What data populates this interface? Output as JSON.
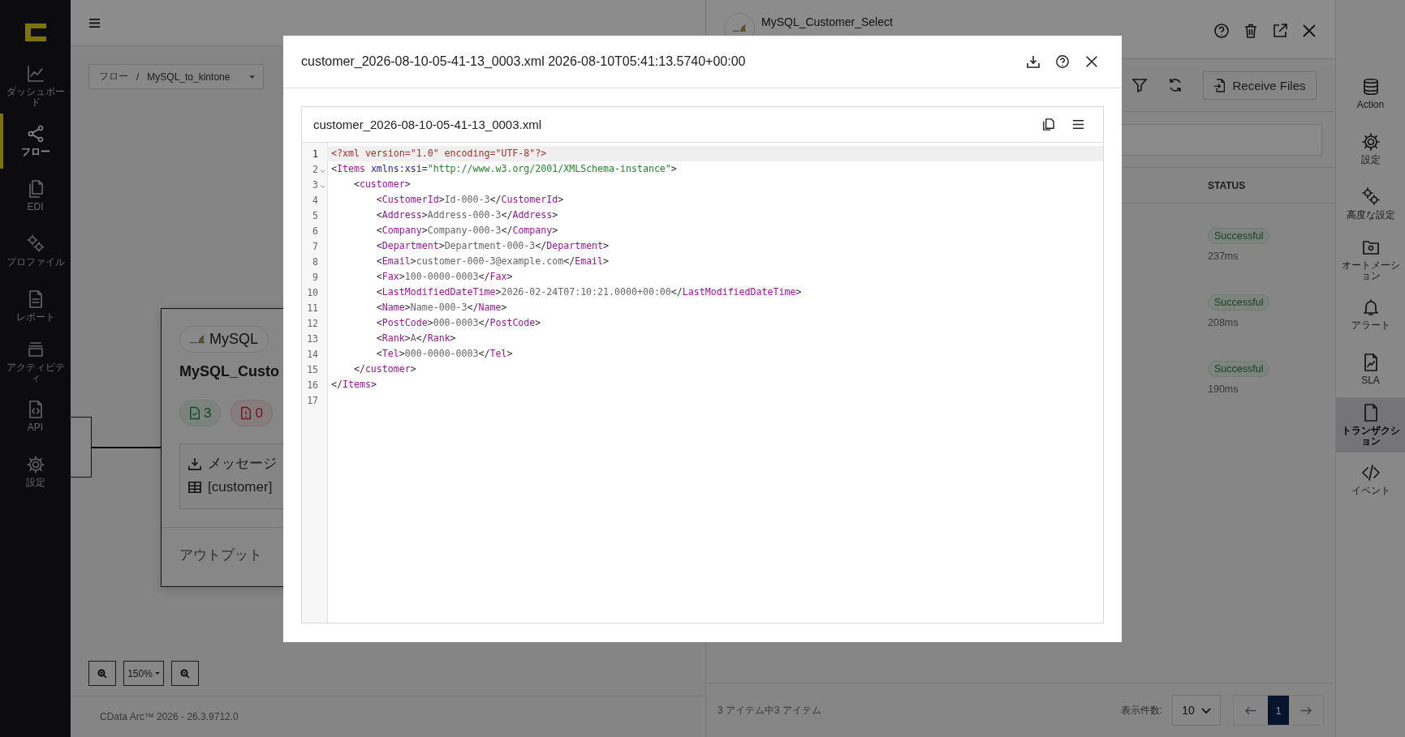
{
  "sidebar": {
    "items": [
      {
        "label": "ダッシュボード",
        "selected": false
      },
      {
        "label": "フロー",
        "selected": true
      },
      {
        "label": "EDI",
        "selected": false
      },
      {
        "label": "プロファイル",
        "selected": false
      },
      {
        "label": "レポート",
        "selected": false
      },
      {
        "label": "アクティビティ",
        "selected": false
      },
      {
        "label": "API",
        "selected": false
      },
      {
        "label": "設定",
        "selected": false
      }
    ]
  },
  "breadcrumb": {
    "root": "フロー",
    "separator": "/",
    "flow": "MySQL_to_kintone"
  },
  "canvas": {
    "node": {
      "connector": "MySQL",
      "title": "MySQL_Custo",
      "success_count": "3",
      "error_count": "0",
      "message_label": "メッセージ",
      "table_label": "[customer]",
      "output_label": "アウトプット"
    },
    "zoom": "150%"
  },
  "footer": "CData Arc™ 2026 - 26.3.9712.0",
  "panel": {
    "title": "MySQL_Customer_Select",
    "receive_button": "Receive Files",
    "columns": [
      "STATUS"
    ],
    "rows": [
      {
        "status": "Successful",
        "duration": "237ms"
      },
      {
        "status": "Successful",
        "duration": "208ms"
      },
      {
        "status": "Successful",
        "duration": "190ms"
      }
    ],
    "summary": "3 アイテム中3 アイテム",
    "page_size_label": "表示件数:",
    "page_size": "10",
    "pages": [
      {
        "label": "1",
        "selected": true
      }
    ]
  },
  "tools": [
    {
      "label": "Action",
      "selected": false
    },
    {
      "label": "設定",
      "selected": false
    },
    {
      "label": "高度な設定",
      "selected": false
    },
    {
      "label": "オートメーション",
      "selected": false
    },
    {
      "label": "アラート",
      "selected": false
    },
    {
      "label": "SLA",
      "selected": false
    },
    {
      "label": "トランザクション",
      "selected": true
    },
    {
      "label": "イベント",
      "selected": false
    }
  ],
  "modal": {
    "title": "customer_2026-08-10-05-41-13_0003.xml 2026-08-10T05:41:13.5740+00:00",
    "editor": {
      "filename": "customer_2026-08-10-05-41-13_0003.xml",
      "lines": [
        {
          "number": "1",
          "code": "<?xml version=\"1.0\" encoding=\"UTF-8\"?>",
          "active": true,
          "fold": false
        },
        {
          "number": "2",
          "code": "<Items xmlns:xsi=\"http://www.w3.org/2001/XMLSchema-instance\">",
          "active": false,
          "fold": true
        },
        {
          "number": "3",
          "code": "    <customer>",
          "active": false,
          "fold": true
        },
        {
          "number": "4",
          "code": "        <CustomerId>Id-000-3</CustomerId>",
          "active": false,
          "fold": false
        },
        {
          "number": "5",
          "code": "        <Address>Address-000-3</Address>",
          "active": false,
          "fold": false
        },
        {
          "number": "6",
          "code": "        <Company>Company-000-3</Company>",
          "active": false,
          "fold": false
        },
        {
          "number": "7",
          "code": "        <Department>Department-000-3</Department>",
          "active": false,
          "fold": false
        },
        {
          "number": "8",
          "code": "        <Email>customer-000-3@example.com</Email>",
          "active": false,
          "fold": false
        },
        {
          "number": "9",
          "code": "        <Fax>100-0000-0003</Fax>",
          "active": false,
          "fold": false
        },
        {
          "number": "10",
          "code": "        <LastModifiedDateTime>2026-02-24T07:10:21.0000+00:00</LastModifiedDateTime>",
          "active": false,
          "fold": false
        },
        {
          "number": "11",
          "code": "        <Name>Name-000-3</Name>",
          "active": false,
          "fold": false
        },
        {
          "number": "12",
          "code": "        <PostCode>000-0003</PostCode>",
          "active": false,
          "fold": false
        },
        {
          "number": "13",
          "code": "        <Rank>A</Rank>",
          "active": false,
          "fold": false
        },
        {
          "number": "14",
          "code": "        <Tel>000-0000-0003</Tel>",
          "active": false,
          "fold": false
        },
        {
          "number": "15",
          "code": "    </customer>",
          "active": false,
          "fold": false
        },
        {
          "number": "16",
          "code": "</Items>",
          "active": false,
          "fold": false
        },
        {
          "number": "17",
          "active": false,
          "fold": false
        }
      ]
    }
  }
}
